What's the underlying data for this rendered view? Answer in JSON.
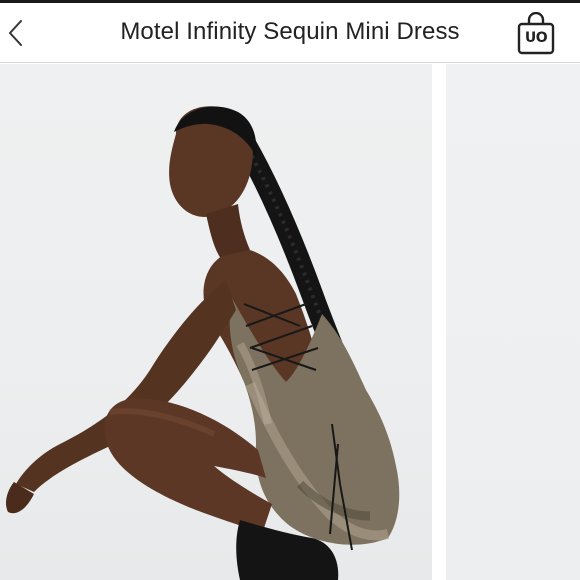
{
  "header": {
    "back_icon": "chevron-left-icon",
    "title": "Motel Infinity Sequin Mini Dress",
    "bag_icon": "shopping-bag-icon",
    "bag_logo": "UO"
  },
  "gallery": {
    "images": [
      {
        "subject": "model-photo"
      },
      {
        "subject": "model-photo"
      }
    ]
  },
  "colors": {
    "text": "#222222",
    "photo_background": "#eceeef"
  }
}
